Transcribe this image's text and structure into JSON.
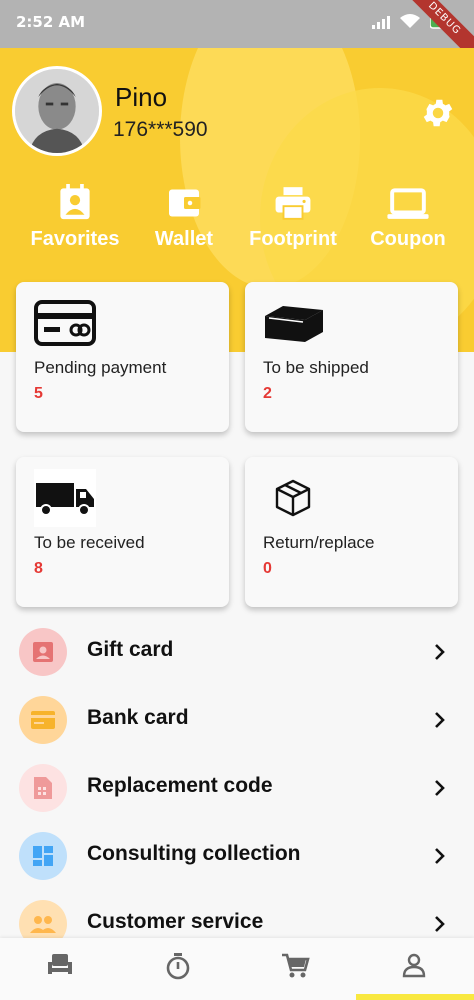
{
  "status_bar": {
    "time": "2:52 AM",
    "debug_label": "DEBUG"
  },
  "profile": {
    "name": "Pino",
    "phone": "176***590"
  },
  "quick_actions": [
    {
      "label": "Favorites",
      "icon": "person-badge-icon"
    },
    {
      "label": "Wallet",
      "icon": "wallet-icon"
    },
    {
      "label": "Footprint",
      "icon": "printer-icon"
    },
    {
      "label": "Coupon",
      "icon": "laptop-icon"
    }
  ],
  "orders": [
    {
      "label": "Pending payment",
      "count": "5",
      "icon": "credit-card-icon"
    },
    {
      "label": "To be shipped",
      "count": "2",
      "icon": "box-icon"
    },
    {
      "label": "To be received",
      "count": "8",
      "icon": "truck-icon"
    },
    {
      "label": "Return/replace",
      "count": "0",
      "icon": "package-icon"
    }
  ],
  "menu": [
    {
      "label": "Gift card",
      "icon": "gift-card-icon",
      "color": "#f8c6c6",
      "icon_color": "#e57373"
    },
    {
      "label": "Bank card",
      "icon": "bank-card-icon",
      "color": "#ffd699",
      "icon_color": "#f7b32b"
    },
    {
      "label": "Replacement code",
      "icon": "sim-card-icon",
      "color": "#fde2e2",
      "icon_color": "#ef9a9a"
    },
    {
      "label": "Consulting collection",
      "icon": "dashboard-icon",
      "color": "#bfe0fb",
      "icon_color": "#42a5f5"
    },
    {
      "label": "Customer service",
      "icon": "group-icon",
      "color": "#ffe0b2",
      "icon_color": "#ffb74d"
    }
  ],
  "bottom_nav": [
    {
      "name": "home-tab",
      "icon": "seat-icon"
    },
    {
      "name": "timer-tab",
      "icon": "timer-icon"
    },
    {
      "name": "cart-tab",
      "icon": "cart-icon"
    },
    {
      "name": "profile-tab",
      "icon": "person-icon",
      "active": true
    }
  ],
  "colors": {
    "header": "#f9cc31",
    "accent": "#f9e840",
    "count": "#e53935"
  }
}
